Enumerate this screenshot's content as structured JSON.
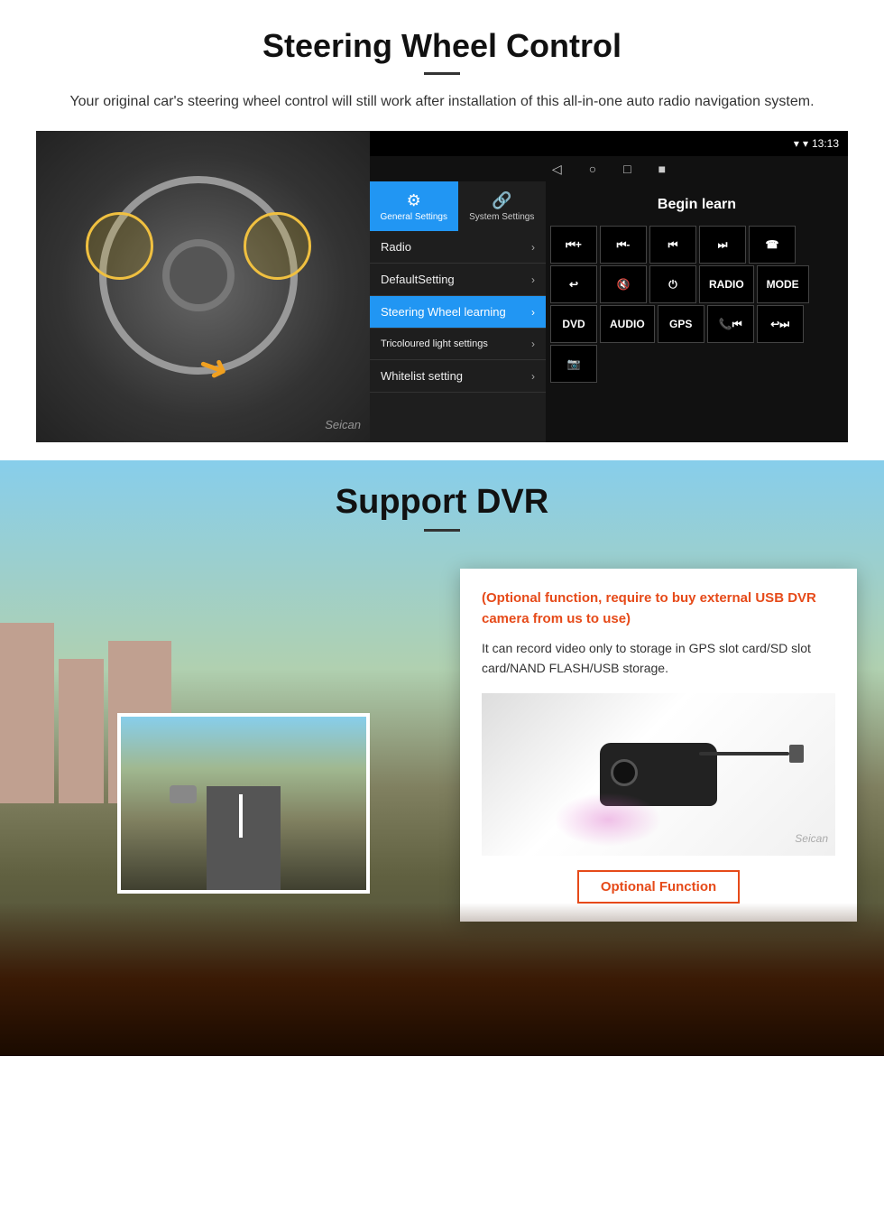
{
  "steering": {
    "title": "Steering Wheel Control",
    "description": "Your original car's steering wheel control will still work after installation of this all-in-one auto radio navigation system.",
    "statusbar": {
      "time": "13:13",
      "signal_icon": "▼",
      "wifi_icon": "▾"
    },
    "nav_icons": [
      "◁",
      "○",
      "□",
      "■"
    ],
    "tabs": [
      {
        "label": "General Settings",
        "icon": "⚙",
        "active": true
      },
      {
        "label": "System Settings",
        "icon": "🔗",
        "active": false
      }
    ],
    "menu_items": [
      {
        "label": "Radio",
        "highlighted": false
      },
      {
        "label": "DefaultSetting",
        "highlighted": false
      },
      {
        "label": "Steering Wheel learning",
        "highlighted": true
      },
      {
        "label": "Tricoloured light settings",
        "highlighted": false
      },
      {
        "label": "Whitelist setting",
        "highlighted": false
      }
    ],
    "begin_learn": "Begin learn",
    "control_buttons": [
      {
        "row": 1,
        "buttons": [
          "⏮+",
          "⏮-",
          "⏮",
          "⏭",
          "☎"
        ]
      },
      {
        "row": 2,
        "buttons": [
          "↩",
          "🔇×",
          "⏻",
          "RADIO",
          "MODE"
        ]
      },
      {
        "row": 3,
        "buttons": [
          "DVD",
          "AUDIO",
          "GPS",
          "📞⏮",
          "↩⏭"
        ]
      },
      {
        "row": 4,
        "buttons": [
          "📷"
        ]
      }
    ],
    "watermark": "Seican"
  },
  "dvr": {
    "title": "Support DVR",
    "optional_text": "(Optional function, require to buy external USB DVR camera from us to use)",
    "body_text": "It can record video only to storage in GPS slot card/SD slot card/NAND FLASH/USB storage.",
    "optional_function_label": "Optional Function",
    "watermark": "Seican"
  }
}
